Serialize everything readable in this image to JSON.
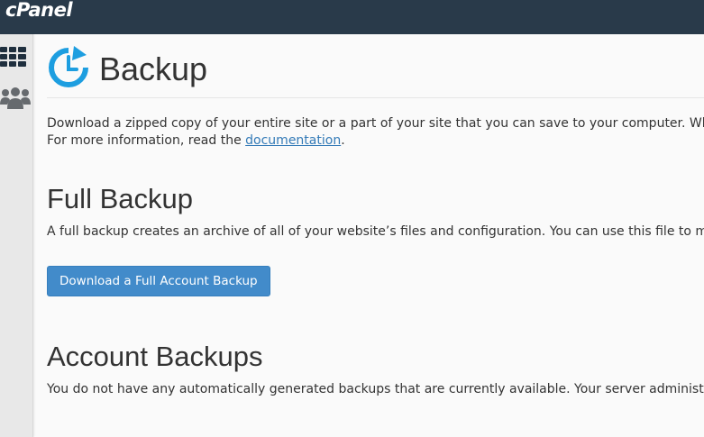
{
  "app": {
    "logo_text": "cPanel"
  },
  "sidebar": {
    "items": [
      {
        "icon": "grid-icon"
      },
      {
        "icon": "users-icon"
      }
    ]
  },
  "page": {
    "title": "Backup",
    "intro_line1": "Download a zipped copy of your entire site or a part of your site that you can save to your computer. When you b",
    "intro_line2_prefix": "For more information, read the ",
    "intro_link": "documentation",
    "intro_line2_suffix": "."
  },
  "full_backup": {
    "title": "Full Backup",
    "description": "A full backup creates an archive of all of your website’s files and configuration. You can use this file to move your",
    "button_label": "Download a Full Account Backup"
  },
  "account_backups": {
    "title": "Account Backups",
    "description": "You do not have any automatically generated backups that are currently available. Your server administrator or s"
  },
  "colors": {
    "topbar": "#293a4a",
    "accent": "#428bca",
    "link": "#337ab7",
    "backup_icon": "#1d9ee0"
  }
}
